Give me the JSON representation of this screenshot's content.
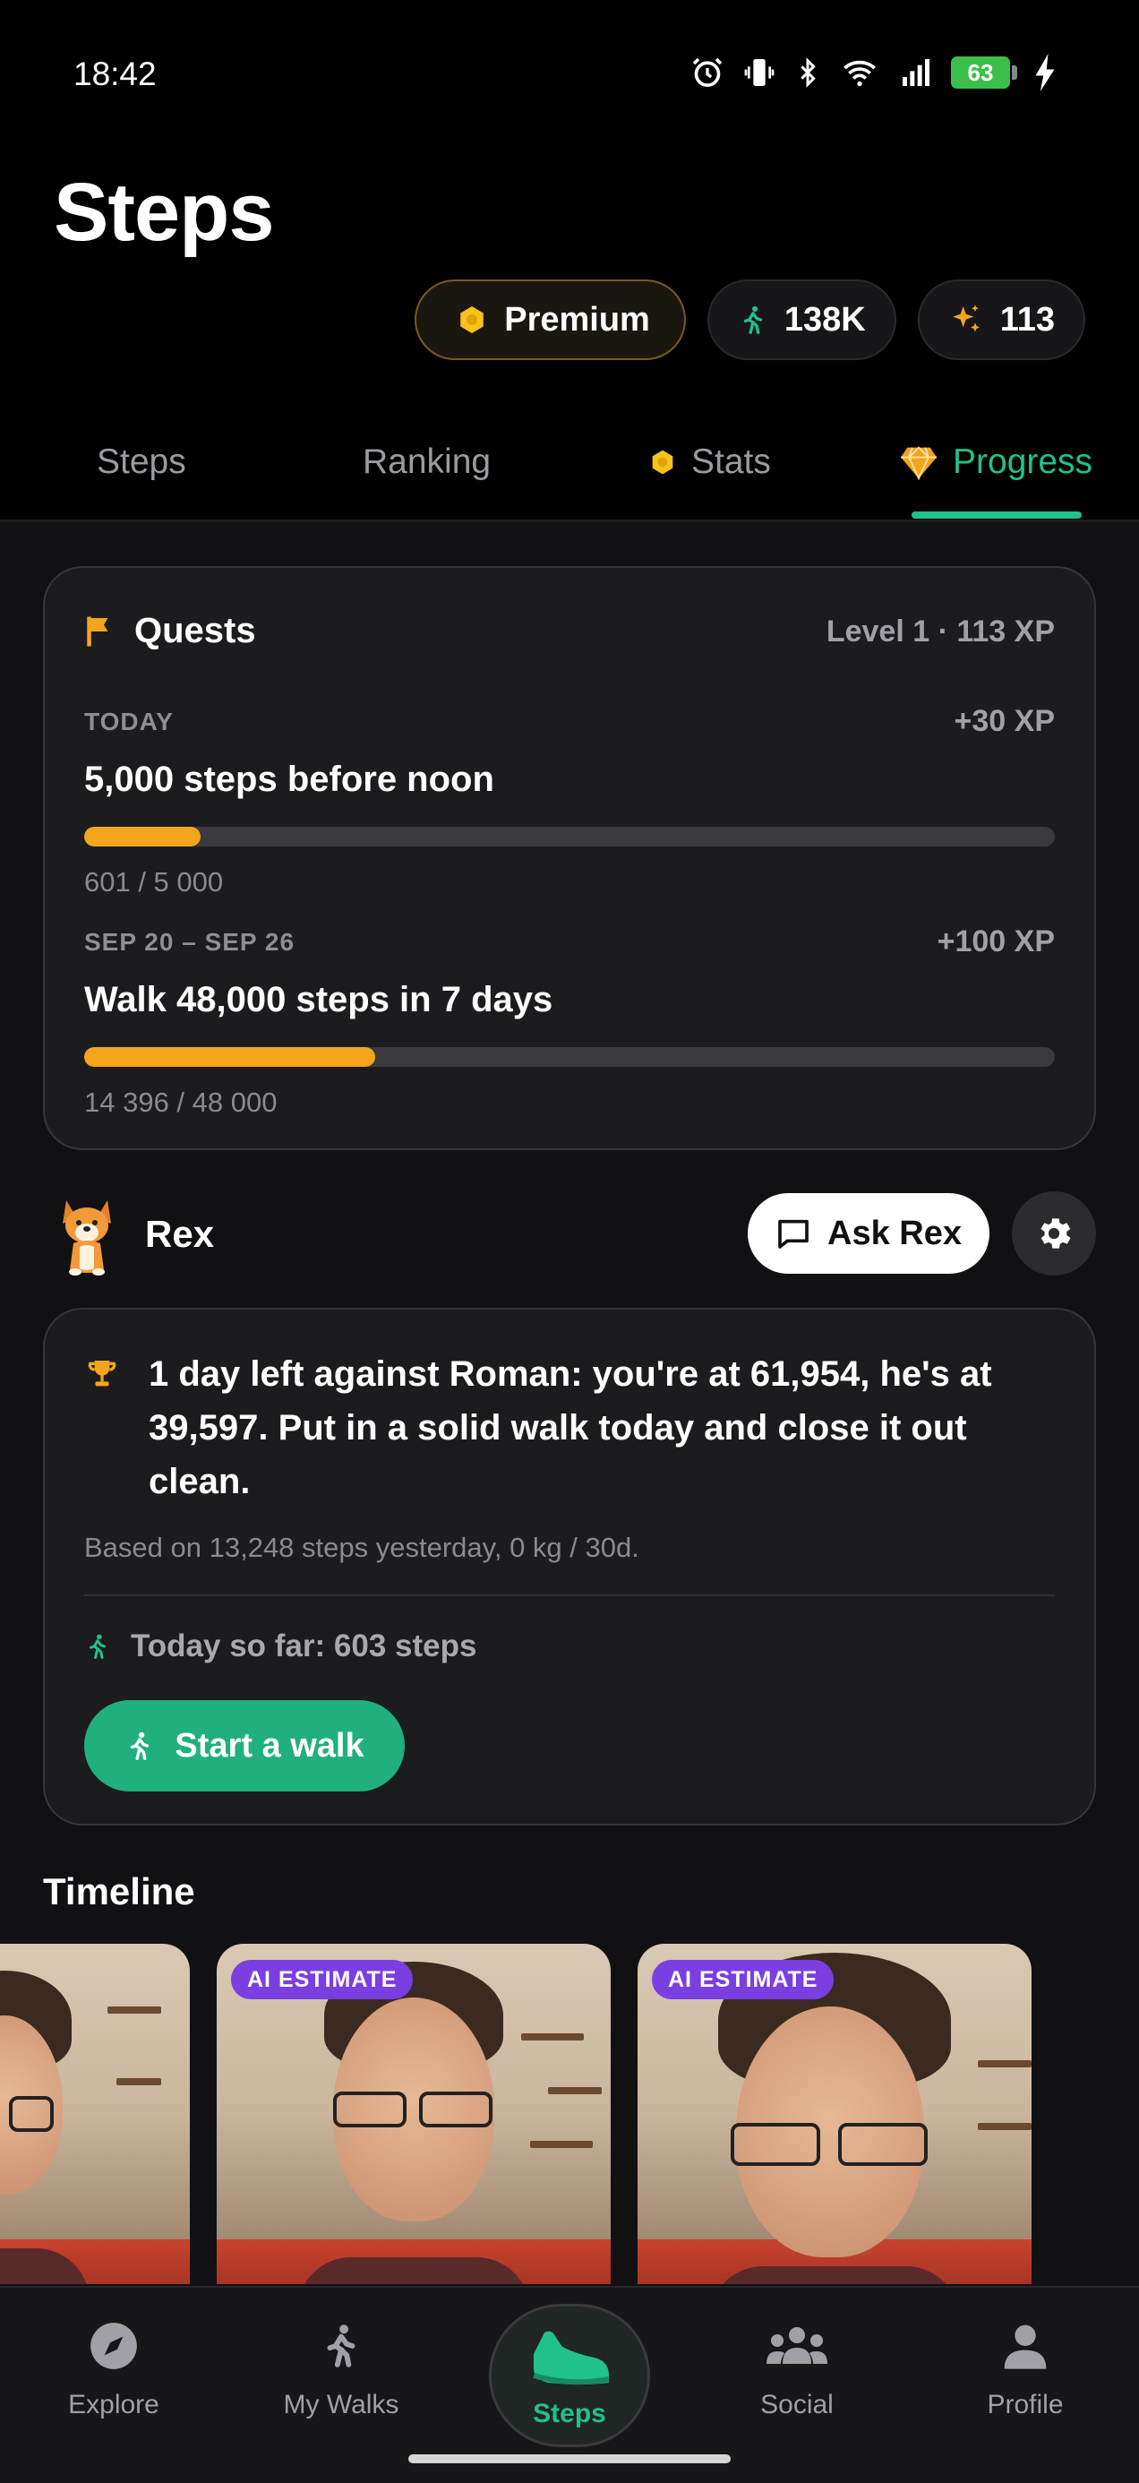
{
  "status_bar": {
    "time": "18:42",
    "battery": "63"
  },
  "header": {
    "title": "Steps",
    "pills": {
      "premium": "Premium",
      "steps": "138K",
      "xp": "113"
    }
  },
  "tabs": {
    "steps": "Steps",
    "ranking": "Ranking",
    "stats": "Stats",
    "progress": "Progress",
    "active": "Progress"
  },
  "quests": {
    "title": "Quests",
    "level": "Level 1 · 113 XP",
    "items": [
      {
        "date": "TODAY",
        "xp": "+30 XP",
        "name": "5,000 steps before noon",
        "progress_text": "601 / 5 000",
        "fraction": 0.1202
      },
      {
        "date": "SEP 20 – SEP 26",
        "xp": "+100 XP",
        "name": "Walk 48,000 steps in 7 days",
        "progress_text": "14 396 / 48 000",
        "fraction": 0.2999
      }
    ]
  },
  "rex": {
    "name": "Rex",
    "ask_label": "Ask Rex",
    "message": "1 day left against Roman: you're at 61,954, he's at 39,597. Put in a solid walk today and close it out clean.",
    "subtext": "Based on 13,248 steps yesterday, 0 kg / 30d.",
    "today": "Today so far: 603 steps",
    "start_walk": "Start a walk"
  },
  "timeline": {
    "title": "Timeline",
    "badges": [
      "AI ESTIMATE",
      "AI ESTIMATE"
    ]
  },
  "bottom_nav": {
    "explore": "Explore",
    "my_walks": "My Walks",
    "steps": "Steps",
    "social": "Social",
    "profile": "Profile"
  },
  "colors": {
    "accent": "#22c08a",
    "gold": "#f4a51c",
    "ai_badge": "#7a3fe0",
    "background": "#111114"
  },
  "icons": [
    "alarm-icon",
    "vibrate-icon",
    "bluetooth-icon",
    "wifi-icon",
    "signal-icon",
    "charging-icon",
    "hexagon-coin-icon",
    "walker-icon",
    "sparkle-icon",
    "gem-icon",
    "flag-icon",
    "chat-icon",
    "gear-icon",
    "trophy-icon",
    "compass-icon",
    "shoe-icon",
    "people-icon",
    "person-icon"
  ]
}
